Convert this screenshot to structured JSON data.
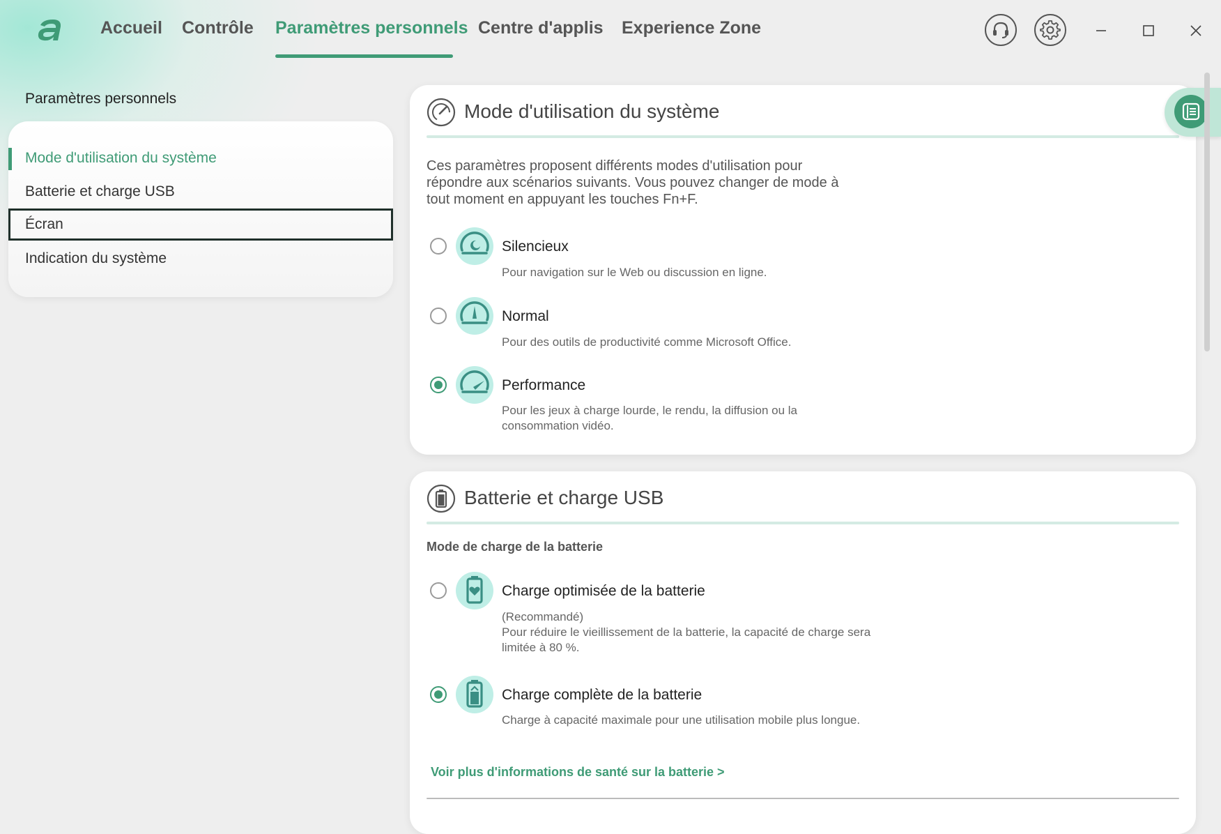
{
  "nav": {
    "tabs": [
      {
        "label": "Accueil"
      },
      {
        "label": "Contrôle"
      },
      {
        "label": "Paramètres personnels"
      },
      {
        "label": "Centre d'applis"
      },
      {
        "label": "Experience Zone"
      }
    ],
    "active_tab": "Paramètres personnels"
  },
  "sidebar": {
    "title": "Paramètres personnels",
    "items": [
      {
        "label": "Mode d'utilisation du système"
      },
      {
        "label": "Batterie et charge USB"
      },
      {
        "label": "Écran"
      },
      {
        "label": "Indication du système"
      }
    ],
    "active_item": "Mode d'utilisation du système",
    "focused_item": "Écran"
  },
  "usage_mode": {
    "title": "Mode d'utilisation du système",
    "description": "Ces paramètres proposent différents modes d'utilisation pour répondre aux scénarios suivants. Vous pouvez changer de mode à tout moment en appuyant les touches Fn+F.",
    "options": [
      {
        "label": "Silencieux",
        "desc": "Pour navigation sur le Web ou discussion en ligne.",
        "icon": "quiet-gauge-icon",
        "selected": false
      },
      {
        "label": "Normal",
        "desc": "Pour des outils de productivité comme Microsoft Office.",
        "icon": "normal-gauge-icon",
        "selected": false
      },
      {
        "label": "Performance",
        "desc": "Pour les jeux à charge lourde, le rendu, la diffusion ou la consommation vidéo.",
        "icon": "performance-gauge-icon",
        "selected": true
      }
    ]
  },
  "battery": {
    "title": "Batterie et charge USB",
    "subheading": "Mode de charge de la batterie",
    "options": [
      {
        "label": "Charge optimisée de la batterie",
        "note": "(Recommandé)",
        "desc": "Pour réduire le vieillissement de la batterie, la capacité de charge sera limitée à 80 %.",
        "icon": "battery-heart-icon",
        "selected": false
      },
      {
        "label": "Charge complète de la batterie",
        "desc": "Charge à capacité maximale pour une utilisation mobile plus longue.",
        "icon": "battery-full-icon",
        "selected": true
      }
    ],
    "link": "Voir plus d'informations de santé sur la batterie >"
  },
  "colors": {
    "accent": "#3f9b76",
    "icon_bg": "#bfeee6",
    "icon_fg": "#3a8f84"
  }
}
